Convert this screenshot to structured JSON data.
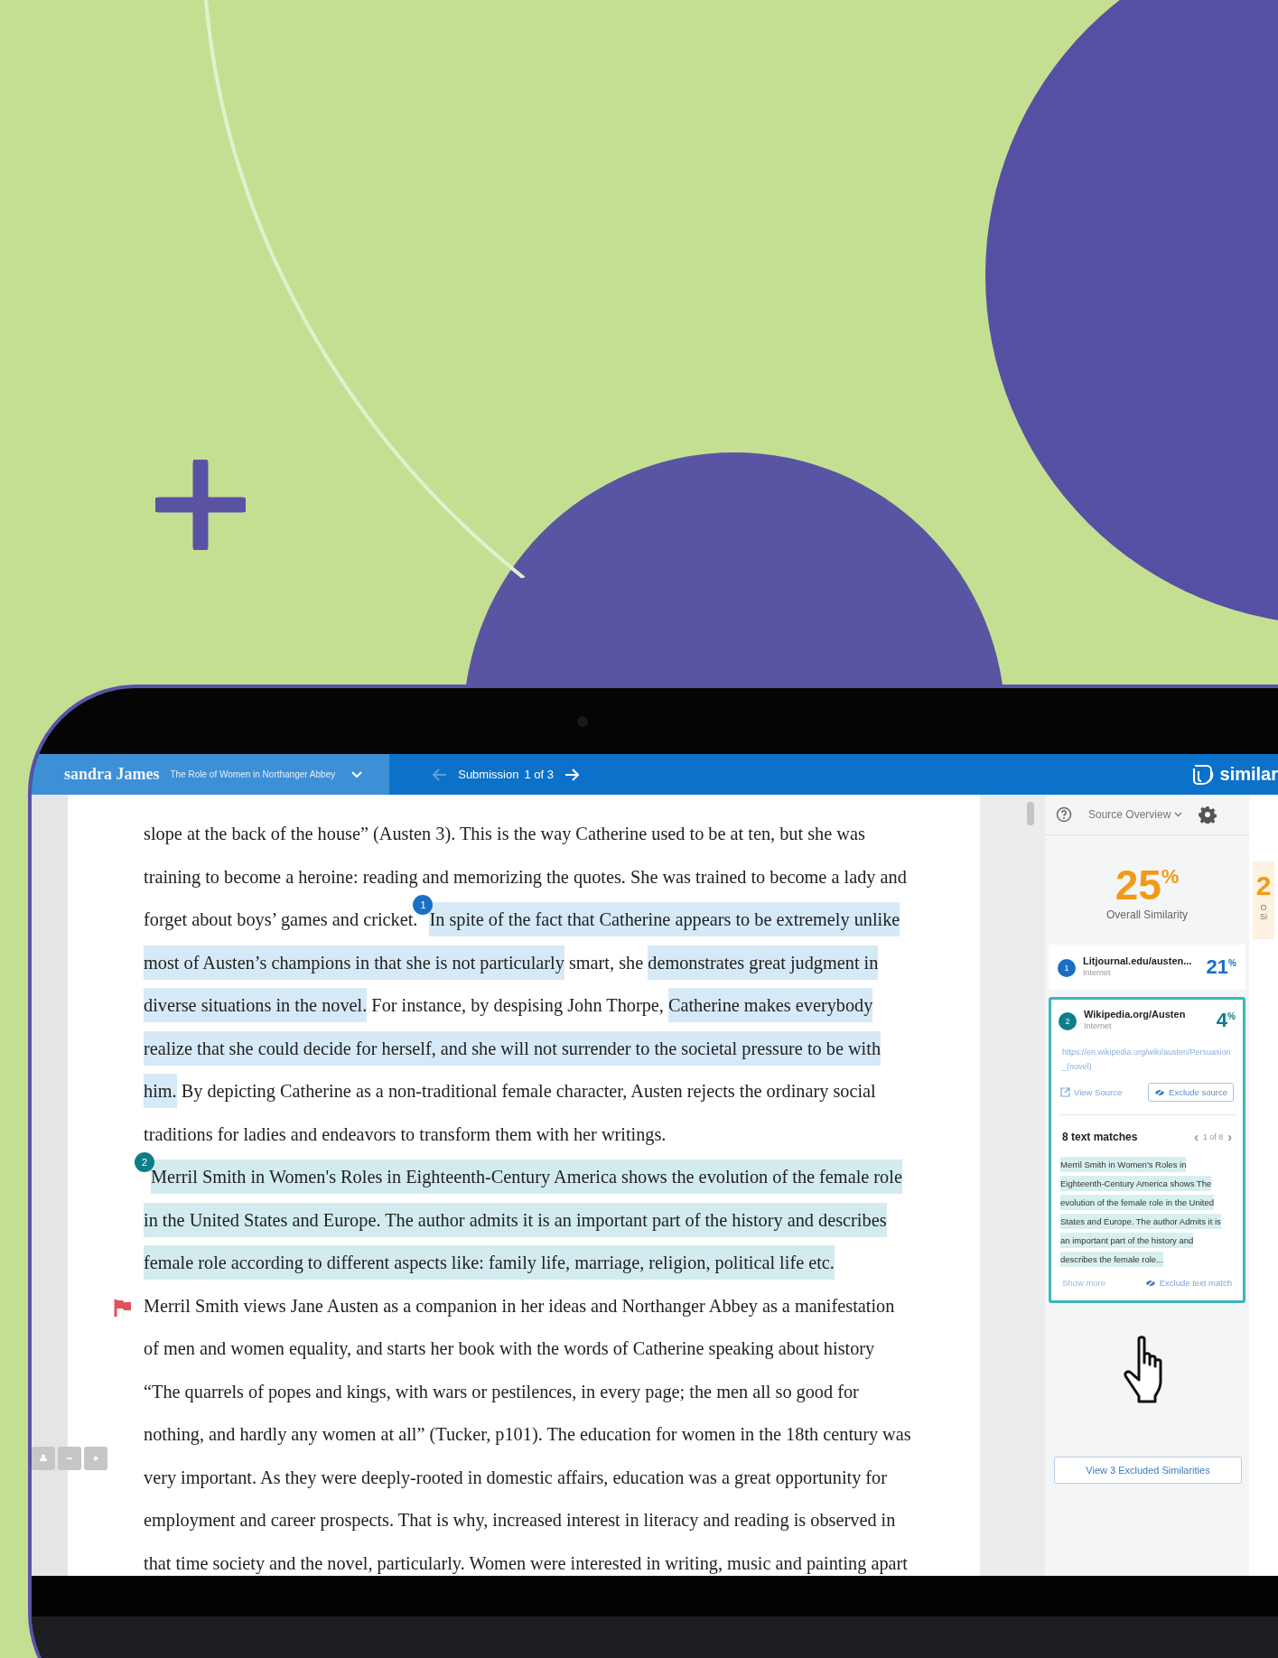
{
  "topbar": {
    "student": "sandra James",
    "title": "The Role of Women in Northanger Abbey",
    "submission_label": "Submission",
    "submission_count": "1 of 3",
    "brand": "similar"
  },
  "document": {
    "paragraphs": [
      {
        "flagged": false,
        "segments": [
          {
            "kind": "text",
            "text": "slope at the back of the house” (Austen 3). This is the way Catherine used to be at ten, but she was training to become a heroine: reading and memorizing the quotes. She was trained to become a lady and forget about boys’ games and cricket. "
          },
          {
            "kind": "marker",
            "text": "1",
            "color": "#1a6fc4"
          },
          {
            "kind": "match",
            "text": "In spite of the fact that Catherine appears to be extremely unlike most of Austen’s champions in that she is not particularly",
            "color": "#d6e9f7"
          },
          {
            "kind": "text",
            "text": " smart, she "
          },
          {
            "kind": "match",
            "text": "demonstrates great judgment in diverse situations in the novel.",
            "color": "#d6e9f7"
          },
          {
            "kind": "text",
            "text": " For instance, by despising John Thorpe, "
          },
          {
            "kind": "match",
            "text": "Catherine makes everybody realize that she could decide for herself, and she will not surrender to the societal pressure to be with him.",
            "color": "#d6e9f7"
          },
          {
            "kind": "text",
            "text": " By depicting Catherine as a non-traditional female character, Austen rejects the ordinary social traditions for ladies and endeavors to transform them with her writings."
          }
        ]
      },
      {
        "flagged": false,
        "segments": [
          {
            "kind": "marker",
            "text": "2",
            "color": "#0e7f86"
          },
          {
            "kind": "match",
            "text": "Merril Smith in Women's Roles in Eighteenth-Century America shows the evolution of the female role in the United States and Europe. The author admits it is an important part of the history and describes female role according to different aspects like: family life, marriage, religion, political life etc.",
            "color": "#d2ebee"
          }
        ]
      },
      {
        "flagged": true,
        "segments": [
          {
            "kind": "text",
            "text": "Merril Smith views Jane Austen as a companion in her ideas and Northanger Abbey as a manifestation of men and women equality, and starts her book with the words of Catherine speaking about history “The quarrels of popes and kings, with wars or pestilences, in every page; the men all so good for nothing, and hardly any women at all” (Tucker, p101). The education for women in the 18th century was very important. As they were deeply-rooted in domestic affairs, education was a great opportunity for employment and career prospects. That is why, increased interest in literacy and reading is observed in that time society and the novel, particularly. Women were interested in writing, music and painting apart"
          }
        ]
      }
    ]
  },
  "panel": {
    "title": "Source Overview",
    "overall": "25$^{%}$",
    "overall_label": "Overall Similarity",
    "sources": [
      {
        "number": "1",
        "color": "#1a6fc4",
        "name": "Litjournal.edu/austen...",
        "type": "Internet",
        "percent": "21$^{%}$",
        "selected": false
      },
      {
        "number": "2",
        "color": "#0e7f86",
        "name": "Wikipedia.org/Austen",
        "type": "Internet",
        "percent": "4$^{%}$",
        "selected": true,
        "url": "https://en.wikipedia.org/wiki/austen/Persuasion_(novel)",
        "view_label": "View Source",
        "exclude_label": "Exclude source",
        "matches_label": "8 text matches",
        "pager_prev": "‹",
        "pager": "1 of 8",
        "pager_next": "›",
        "excerpt": "Merril Smith in Women's Roles in Eighteenth-Century America shows The evolution of the female role in the United States and Europe. The author Admits it is an important part of the history and describes the female role...",
        "show_more": "Show more",
        "exclude_match": "Exclude text match"
      }
    ],
    "excluded_button": "View 3 Excluded Similarities"
  },
  "side_summary": {
    "value": "2",
    "lines": [
      "O",
      "Si"
    ]
  }
}
